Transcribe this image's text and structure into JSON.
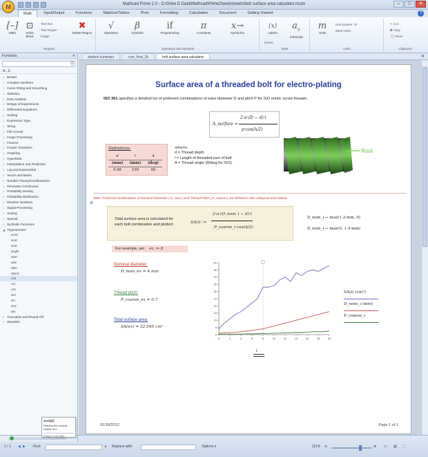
{
  "window": {
    "title": "Mathcad Prime 2.0 - D:\\Drive D Data\\Mathcad\\Prime2\\worksheets\\bolt surface area calculator.mcdx",
    "buttons": [
      "–",
      "□",
      "✕"
    ]
  },
  "ribbon": {
    "tabs": [
      "Math",
      "Input/Output",
      "Functions",
      "Matrices/Tables",
      "Plots",
      "Formatting",
      "Calculation",
      "Document",
      "Getting Started"
    ],
    "active_tab": "Math",
    "groups": {
      "regions": {
        "label": "Regions",
        "math": "Math",
        "solve_block": "Solve Block",
        "text_box": "Text Box",
        "text_region": "Text Region",
        "image": "Image",
        "delete_region": "Delete Region"
      },
      "operators": {
        "label": "Operators and Symbols",
        "operators": "Operators",
        "symbols": "Symbols",
        "programming": "Programming",
        "constants": "Constants",
        "symbolics": "Symbolics"
      },
      "style": {
        "label": "Style",
        "labels": "Labels",
        "subscript": "Subscript",
        "labels_value": "(none)"
      },
      "units": {
        "label": "Units",
        "units": "Units",
        "unit_system": "Unit System: SI",
        "base_units": "Base Units"
      },
      "clipboard": {
        "label": "Clipboard",
        "cut": "Cut",
        "copy": "Copy",
        "paste": "Paste"
      }
    }
  },
  "functions_panel": {
    "title": "Functions",
    "sort_label": "A↓ Z↓",
    "categories": [
      "Bessel",
      "Complex Numbers",
      "Curve Fitting and Smoothing",
      "Statistics",
      "Data Analysis",
      "Design of Experiments",
      "Differential Equations",
      "Solving",
      "Expression Type",
      "String",
      "File Access",
      "Image Processing",
      "Finance",
      "Fourier Transform",
      "Graphing",
      "Hyperbolic",
      "Interpolation and Prediction",
      "Log and Exponential",
      "Vector and Matrix",
      "Number Theory/Combinatorics",
      "Piecewise Continuous",
      "Probability Density",
      "Probability Distribution",
      "Random Numbers",
      "Signal Processing",
      "Sorting",
      "Special",
      "Symbolic Functions",
      "Trigonometric"
    ],
    "trig_functions": [
      "acos",
      "acot",
      "acsc",
      "angle",
      "asec",
      "asin",
      "atan",
      "atan2",
      "cos",
      "cot",
      "csc",
      "sec",
      "sin",
      "sinc",
      "tan"
    ],
    "trailing_categories": [
      "Truncation and Round-Off",
      "Wavelets"
    ],
    "tooltip": {
      "title": "acos(z)",
      "description": "Returns the inverse cosine of z.",
      "help": "Press F1 for help"
    }
  },
  "doc_tabs": [
    "student summary",
    "com_final_2b",
    "bolt surface area calculator"
  ],
  "worksheet": {
    "title": "Surface area of a threaded bolt for electro-plating",
    "intro_bold": "ISO 261",
    "intro_text": " specifies a detailed list of preferred combinations of outer diameter D and pitch P for ISO metric screw threads.",
    "formula": {
      "lhs": "A_surface =",
      "numerator": "2·π·(D − d)·l",
      "denominator": "p·cos(A/2)"
    },
    "definitions": {
      "title": "Definitions:",
      "vars": [
        "d",
        "l",
        "A"
      ],
      "units": [
        "(mm)",
        "(mm)",
        "(deg)"
      ],
      "values": [
        "0.86",
        "100",
        "60"
      ]
    },
    "where": {
      "label": "where:",
      "lines": [
        "d = Thread depth",
        "l = Length of threaded part of bolt",
        "A = Thread angle (60deg for ISO)"
      ]
    },
    "image_label": "Root",
    "note": "Note:  Preferred combinations of Nominal Diameter ( D_nom ) and Thread Pitch ( P_coarse ) are defined in the collapsed area below:",
    "total": {
      "text_line1": "Total surface area is calculated for",
      "text_line2": "each bolt combination and plotted:",
      "lhs": "SA(i) :=",
      "numerator": "2·π·(D_nom_i − d)·l",
      "denominator": "P_coarse_i·cos(A/2)"
    },
    "dnom_defs": [
      "D_nom_i → max(1.2·mm, 0)",
      "D_nom_i → max(0, 1.4·mm)"
    ],
    "example": {
      "label": "For example, set:",
      "expr": "ex := 8"
    },
    "nominal": {
      "label": "Nominal diameter:",
      "value": "D_nom_ex = 4 mm"
    },
    "pitch": {
      "label": "Thread pitch:",
      "value": "P_coarse_ex = 0.7"
    },
    "total_area": {
      "label": "Total surface area:",
      "value": "SA(ex) = 32.545 cm²"
    },
    "legend": [
      "SA(i)  (cm²)",
      "D_nom_i  (mm)",
      "P_coarse_i"
    ],
    "chart_x_label": "i",
    "footer_date": "01/18/2012",
    "footer_page": "Page 1 of 1",
    "colors": {
      "title": "#2a3f99",
      "sa_series": "#6a6fb8",
      "dnom_series": "#b85a4a",
      "pitch_series": "#3a7a3a",
      "note": "#c0392b"
    }
  },
  "chart_data": {
    "type": "line",
    "x": [
      0,
      1,
      2,
      3,
      4,
      5,
      6,
      7,
      8,
      9,
      10,
      11,
      12,
      13,
      14,
      15,
      16,
      17,
      18,
      19,
      20
    ],
    "x_ticks": [
      "0",
      "1",
      "2",
      "3",
      "4",
      "5",
      "6",
      "7",
      "8",
      "9",
      "10",
      "11",
      "12",
      "13",
      "14",
      "15",
      "16",
      "17",
      "18",
      "19",
      "20"
    ],
    "y_ticks": [
      "0",
      "5",
      "10",
      "15",
      "20",
      "25",
      "30",
      "35",
      "40",
      "45",
      "50"
    ],
    "xlim": [
      0,
      20
    ],
    "ylim": [
      0,
      50
    ],
    "xlabel": "i",
    "series": [
      {
        "name": "SA(i)",
        "color": "#6a6fb8",
        "values": [
          4,
          8,
          11,
          14,
          16,
          19,
          22,
          25,
          33,
          33,
          34,
          38,
          40,
          37,
          43,
          41,
          44,
          45,
          44,
          46,
          48
        ]
      },
      {
        "name": "D_nom_i",
        "color": "#b85a4a",
        "values": [
          1,
          1.2,
          1.4,
          1.6,
          2,
          2.5,
          3,
          3.5,
          4,
          5,
          6,
          7,
          8,
          9,
          10,
          11,
          12,
          13,
          14,
          15,
          16
        ]
      },
      {
        "name": "P_coarse_i",
        "color": "#3a7a3a",
        "values": [
          0.25,
          0.25,
          0.3,
          0.35,
          0.4,
          0.45,
          0.5,
          0.6,
          0.7,
          0.8,
          1,
          1,
          1.25,
          1.25,
          1.5,
          1.5,
          1.75,
          2,
          2,
          2,
          2.5
        ]
      }
    ]
  },
  "statusbar": {
    "page": "1 / 1",
    "find_label": "Find:",
    "replace_label": "Replace with:",
    "options_label": "Options ▾",
    "zoom": "111%"
  }
}
